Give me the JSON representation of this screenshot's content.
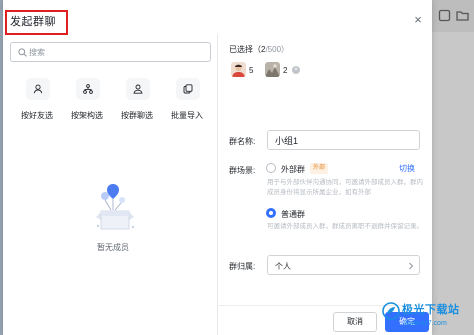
{
  "dialog": {
    "title": "发起群聊",
    "close_symbol": "×"
  },
  "left": {
    "search_placeholder": "搜索",
    "quick_actions": [
      {
        "label": "按好友选",
        "icon": "person-icon"
      },
      {
        "label": "按架构选",
        "icon": "org-tree-icon"
      },
      {
        "label": "按群聊选",
        "icon": "group-chat-icon"
      },
      {
        "label": "批量导入",
        "icon": "import-icon"
      }
    ],
    "empty_text": "暂无成员"
  },
  "right": {
    "selected_label": "已选择",
    "selected_count": "（2",
    "selected_max": "/500）",
    "selected_items": [
      {
        "name": "5",
        "removable": false
      },
      {
        "name": "2",
        "removable": true
      }
    ],
    "group_name_label": "群名称:",
    "group_name_value": "小组1",
    "scene_label": "群场景:",
    "scene_options": [
      {
        "label": "外部群",
        "tag": "外部",
        "selected": false,
        "hint": "用于与外部伙伴沟通协同，可邀请外部成员入群。群内成员身份将显示所属企业，如有外部"
      },
      {
        "label": "普通群",
        "selected": true,
        "hint": "可邀请外部成员入群，群成员离职不退群并保留记录。"
      }
    ],
    "switch_label": "切换",
    "owner_label": "群归属:",
    "owner_value": "个人",
    "cancel_label": "取消",
    "ok_label": "确定"
  },
  "watermark": {
    "main": "极光下载站",
    "sub": "www.xz7.com"
  },
  "colors": {
    "accent": "#3370ff",
    "highlight_box": "#e02020",
    "external_tag_bg": "#fdf1e3",
    "external_tag_text": "#e68a2e",
    "watermark": "#1a8fe0"
  }
}
